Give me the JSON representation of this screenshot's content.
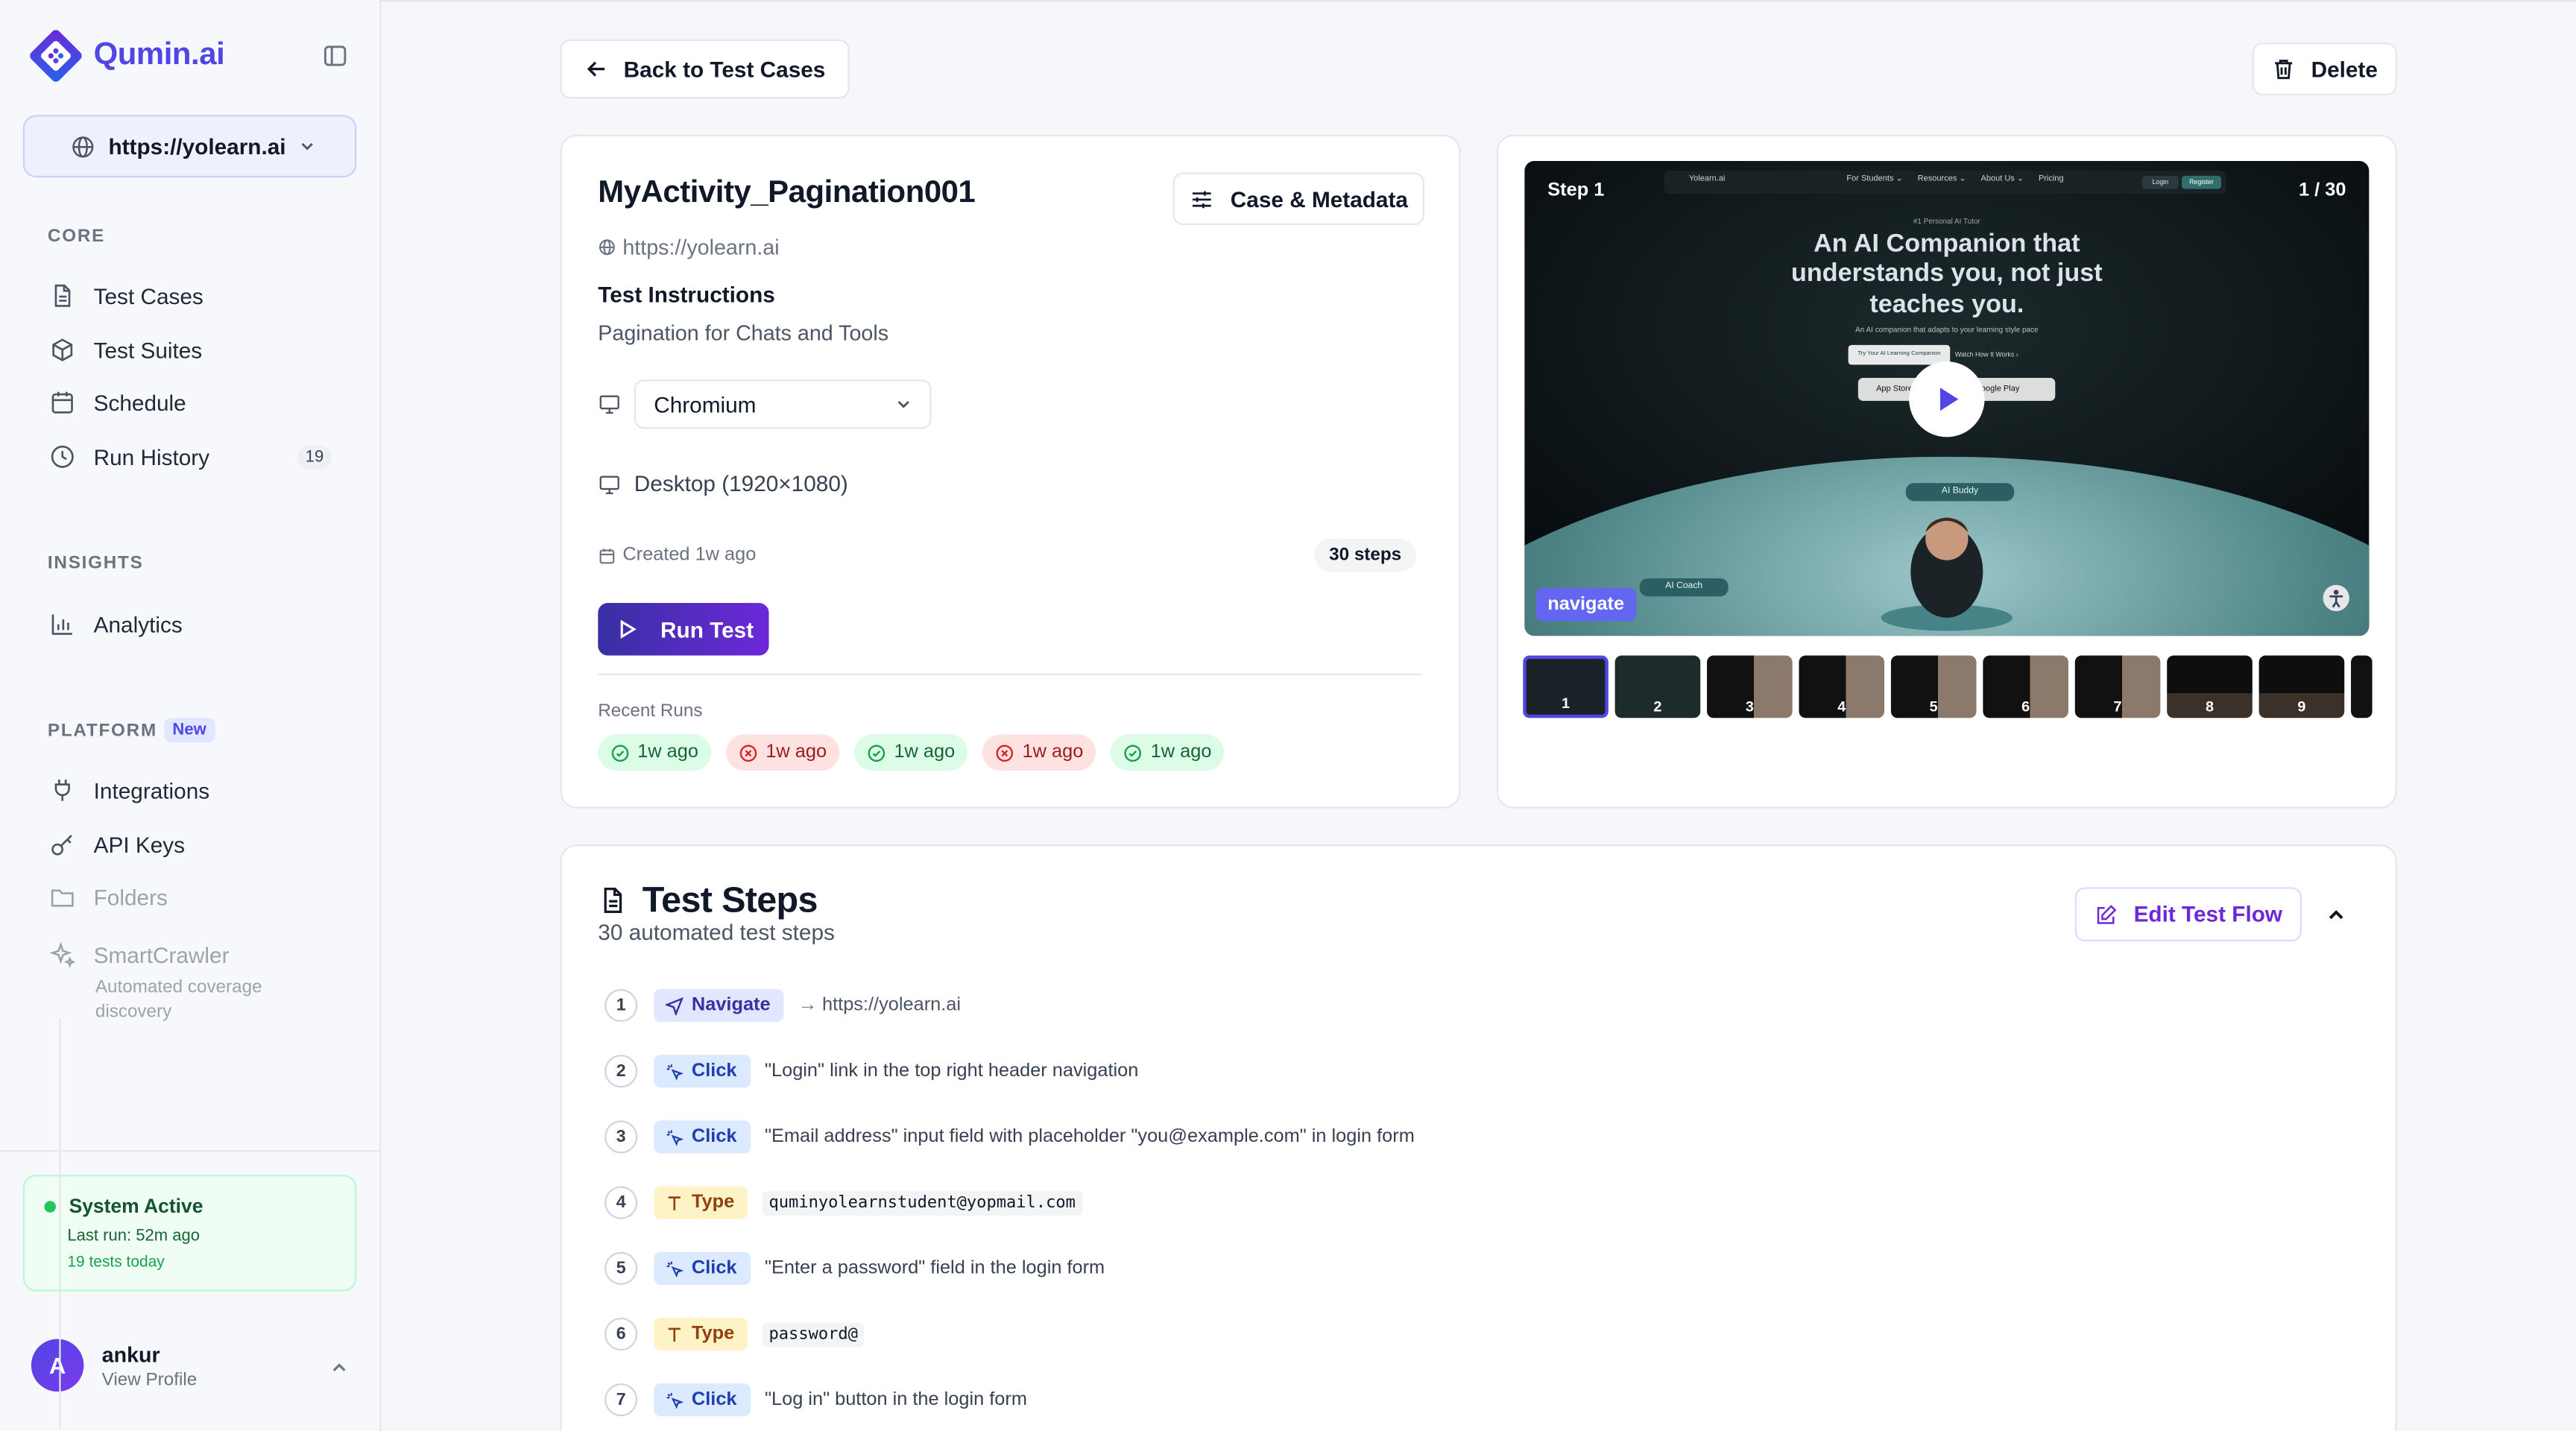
{
  "app": {
    "brand": "Qumin.ai",
    "accent": "#4f46e5"
  },
  "site_selector": {
    "value": "https://yolearn.ai"
  },
  "sidebar": {
    "core_label": "CORE",
    "core_items": [
      {
        "label": "Test Cases",
        "icon": "file-icon"
      },
      {
        "label": "Test Suites",
        "icon": "package-icon"
      },
      {
        "label": "Schedule",
        "icon": "calendar-icon"
      },
      {
        "label": "Run History",
        "icon": "clock-icon",
        "count": "19"
      }
    ],
    "insights_label": "INSIGHTS",
    "insights_items": [
      {
        "label": "Analytics",
        "icon": "bar-chart-icon"
      }
    ],
    "platform_label": "PLATFORM",
    "platform_badge": "New",
    "platform_items": [
      {
        "label": "Integrations",
        "icon": "plug-icon"
      },
      {
        "label": "API Keys",
        "icon": "key-icon"
      },
      {
        "label": "Folders",
        "icon": "folder-icon"
      },
      {
        "label": "SmartCrawler",
        "icon": "sparkle-icon",
        "desc": "Automated coverage discovery"
      }
    ]
  },
  "system": {
    "status": "System Active",
    "last_run": "Last run: 52m ago",
    "tests_today": "19 tests today"
  },
  "profile": {
    "initial": "A",
    "name": "ankur",
    "sub": "View Profile"
  },
  "toolbar": {
    "back_label": "Back to Test Cases",
    "delete_label": "Delete"
  },
  "test_case": {
    "title": "MyActivity_Pagination001",
    "url": "https://yolearn.ai",
    "meta_button": "Case & Metadata",
    "instructions_heading": "Test Instructions",
    "instructions": "Pagination for Chats and Tools",
    "browser": "Chromium",
    "viewport": "Desktop (1920×1080)",
    "created": "Created 1w ago",
    "steps_badge": "30 steps",
    "run_button": "Run Test",
    "recent_runs_label": "Recent Runs",
    "recent_runs": [
      {
        "status": "pass",
        "label": "1w ago"
      },
      {
        "status": "fail",
        "label": "1w ago"
      },
      {
        "status": "pass",
        "label": "1w ago"
      },
      {
        "status": "fail",
        "label": "1w ago"
      },
      {
        "status": "pass",
        "label": "1w ago"
      }
    ]
  },
  "preview": {
    "step_label": "Step 1",
    "counter": "1 / 30",
    "hero_kicker": "#1 Personal AI Tutor",
    "hero_line1": "An AI Companion that",
    "hero_line2": "understands you, not just",
    "hero_line3": "teaches you.",
    "hero_sub": "An AI companion that adapts to your learning style pace",
    "cta1": "Try Your AI Learning Companion",
    "cta2": "Watch How It Works ›",
    "app_store": "App Store",
    "google_play": "Google Play",
    "bubble_buddy": "AI Buddy",
    "bubble_coach": "AI Coach",
    "nav_site": "Yolearn.ai",
    "nav_links": [
      "For Students ⌄",
      "Resources ⌄",
      "About Us ⌄",
      "Pricing"
    ],
    "nav_login": "Login",
    "nav_register": "Register",
    "action_tag": "navigate",
    "thumbnails": [
      "1",
      "2",
      "3",
      "4",
      "5",
      "6",
      "7",
      "8",
      "9"
    ]
  },
  "test_steps": {
    "title": "Test Steps",
    "subtitle": "30 automated test steps",
    "edit_button": "Edit Test Flow",
    "steps": [
      {
        "num": "1",
        "action": "Navigate",
        "kind": "nav",
        "arrow": "→",
        "desc": "https://yolearn.ai"
      },
      {
        "num": "2",
        "action": "Click",
        "kind": "click",
        "desc": "\"Login\" link in the top right header navigation"
      },
      {
        "num": "3",
        "action": "Click",
        "kind": "click",
        "desc": "\"Email address\" input field with placeholder \"you@example.com\" in login form"
      },
      {
        "num": "4",
        "action": "Type",
        "kind": "type",
        "code": "quminyolearnstudent@yopmail.com"
      },
      {
        "num": "5",
        "action": "Click",
        "kind": "click",
        "desc": "\"Enter a password\" field in the login form"
      },
      {
        "num": "6",
        "action": "Type",
        "kind": "type",
        "code": "password@"
      },
      {
        "num": "7",
        "action": "Click",
        "kind": "click",
        "desc": "\"Log in\" button in the login form"
      }
    ]
  }
}
